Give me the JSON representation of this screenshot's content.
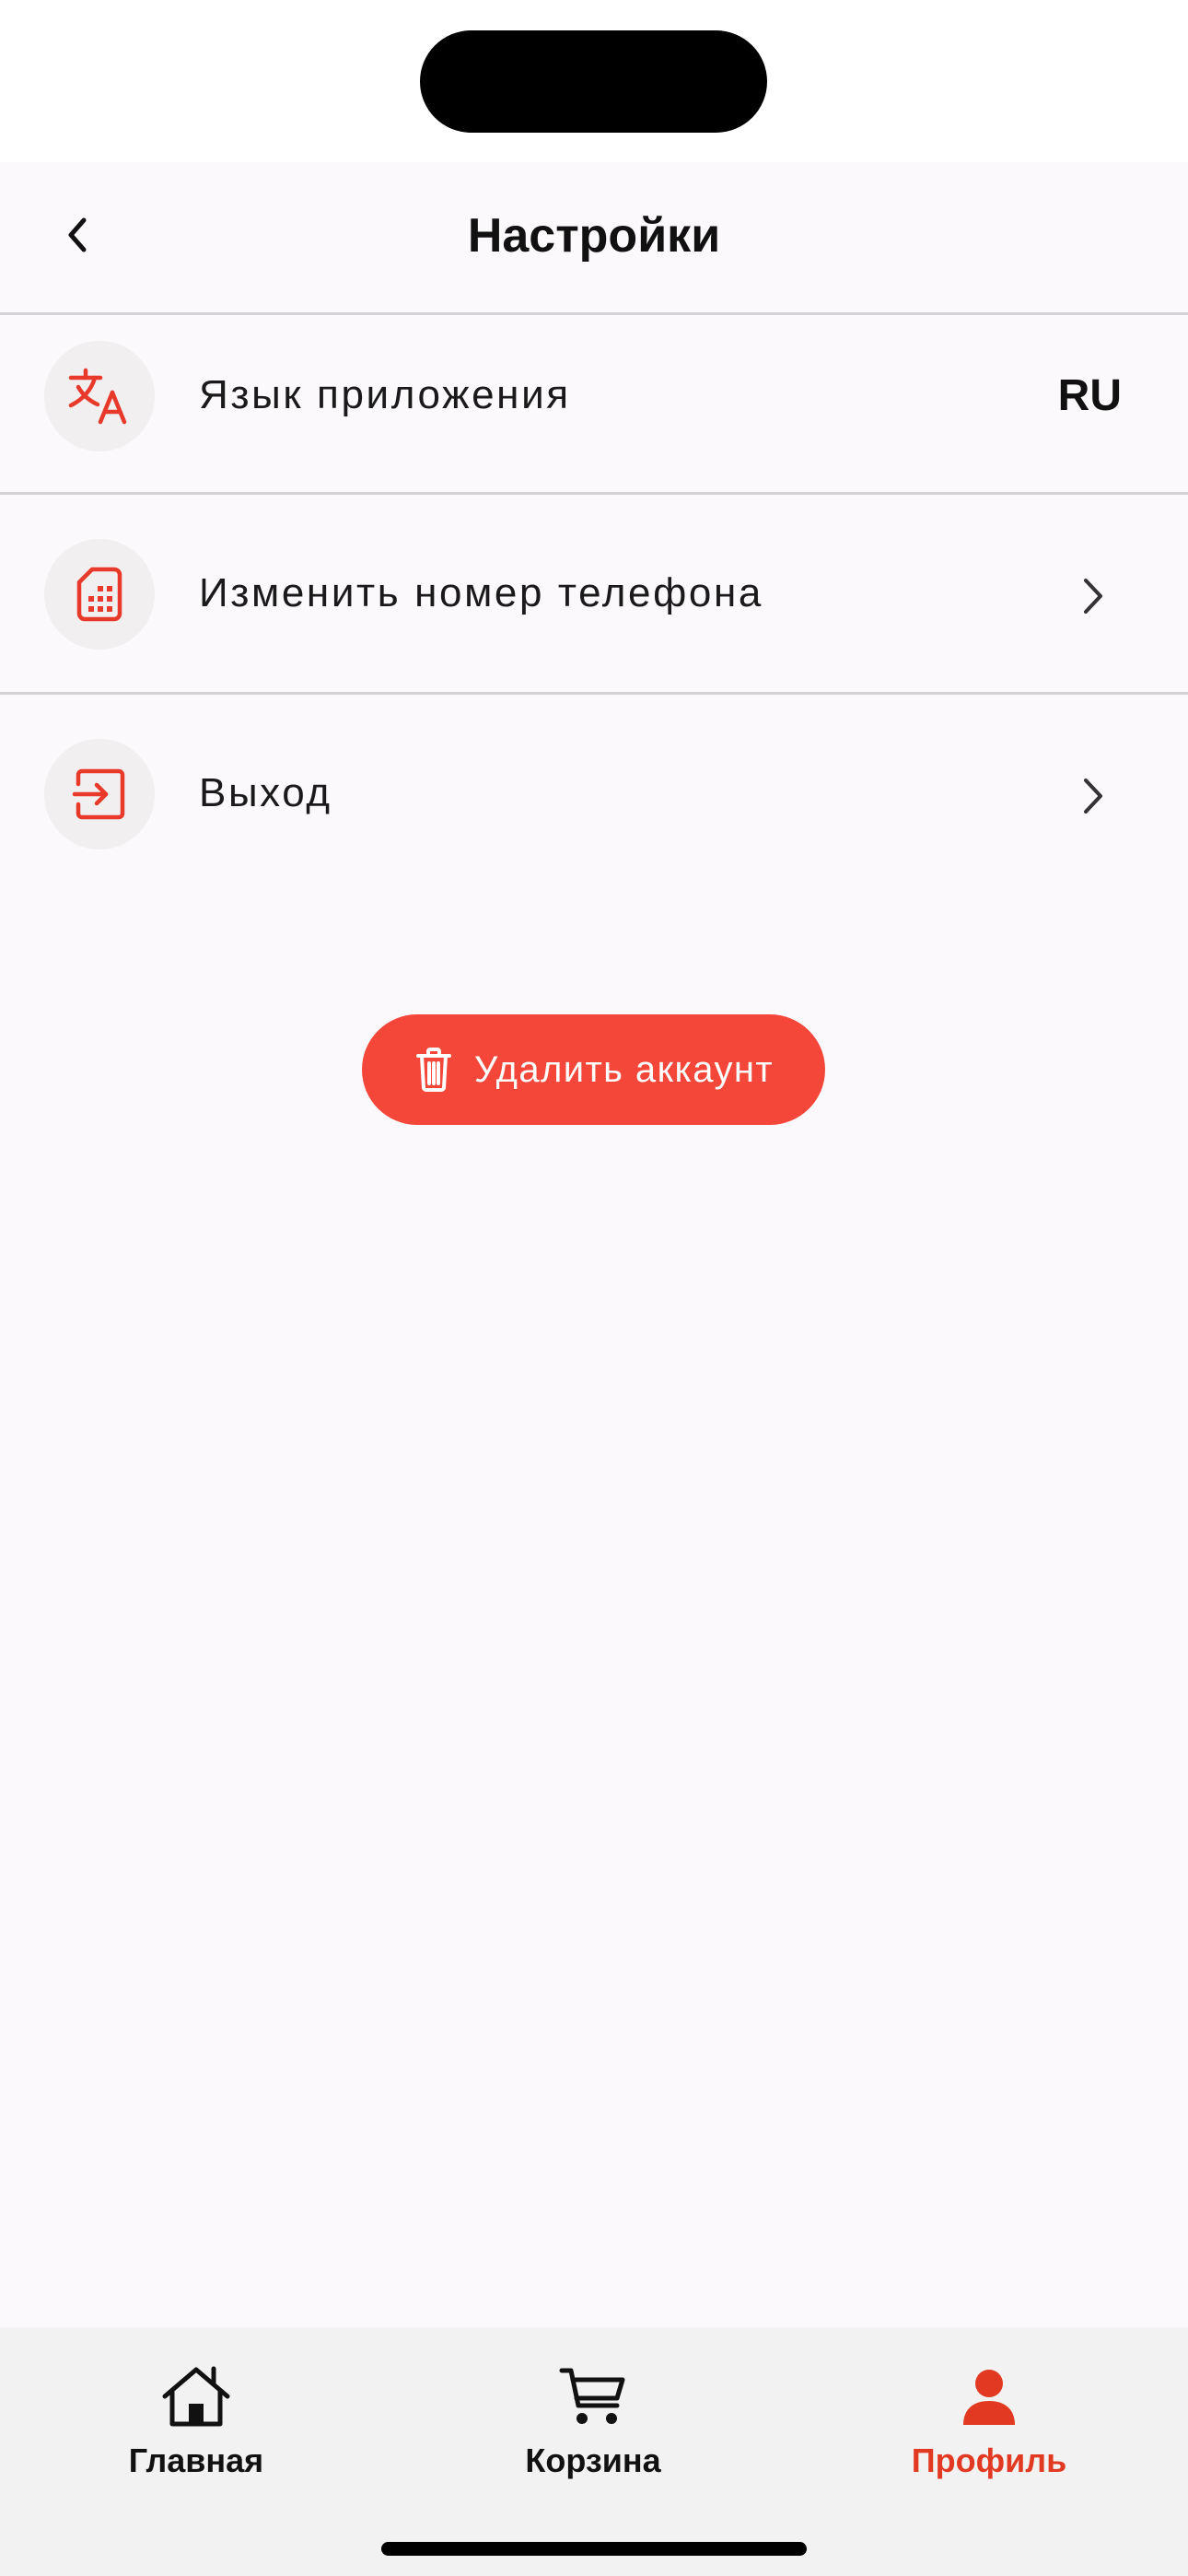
{
  "header": {
    "title": "Настройки",
    "back_icon": "chevron-left-icon"
  },
  "settings": {
    "items": [
      {
        "label": "Язык приложения",
        "value": "RU",
        "icon": "translate-icon"
      },
      {
        "label": "Изменить номер телефона",
        "icon": "sim-card-icon",
        "trailing_icon": "chevron-right-icon"
      },
      {
        "label": "Выход",
        "icon": "exit-icon",
        "trailing_icon": "chevron-right-icon"
      }
    ]
  },
  "delete_account": {
    "label": "Удалить аккаунт",
    "icon": "trash-icon"
  },
  "tabbar": {
    "items": [
      {
        "label": "Главная",
        "icon": "home-icon",
        "active": false
      },
      {
        "label": "Корзина",
        "icon": "cart-icon",
        "active": false
      },
      {
        "label": "Профиль",
        "icon": "person-icon",
        "active": true
      }
    ]
  },
  "colors": {
    "accent": "#e23a22",
    "button": "#f4473a",
    "background": "#fbf9fb",
    "icon_circle": "#f1efef",
    "divider": "#d4d2d6",
    "tabbar": "#f3f2f3"
  }
}
